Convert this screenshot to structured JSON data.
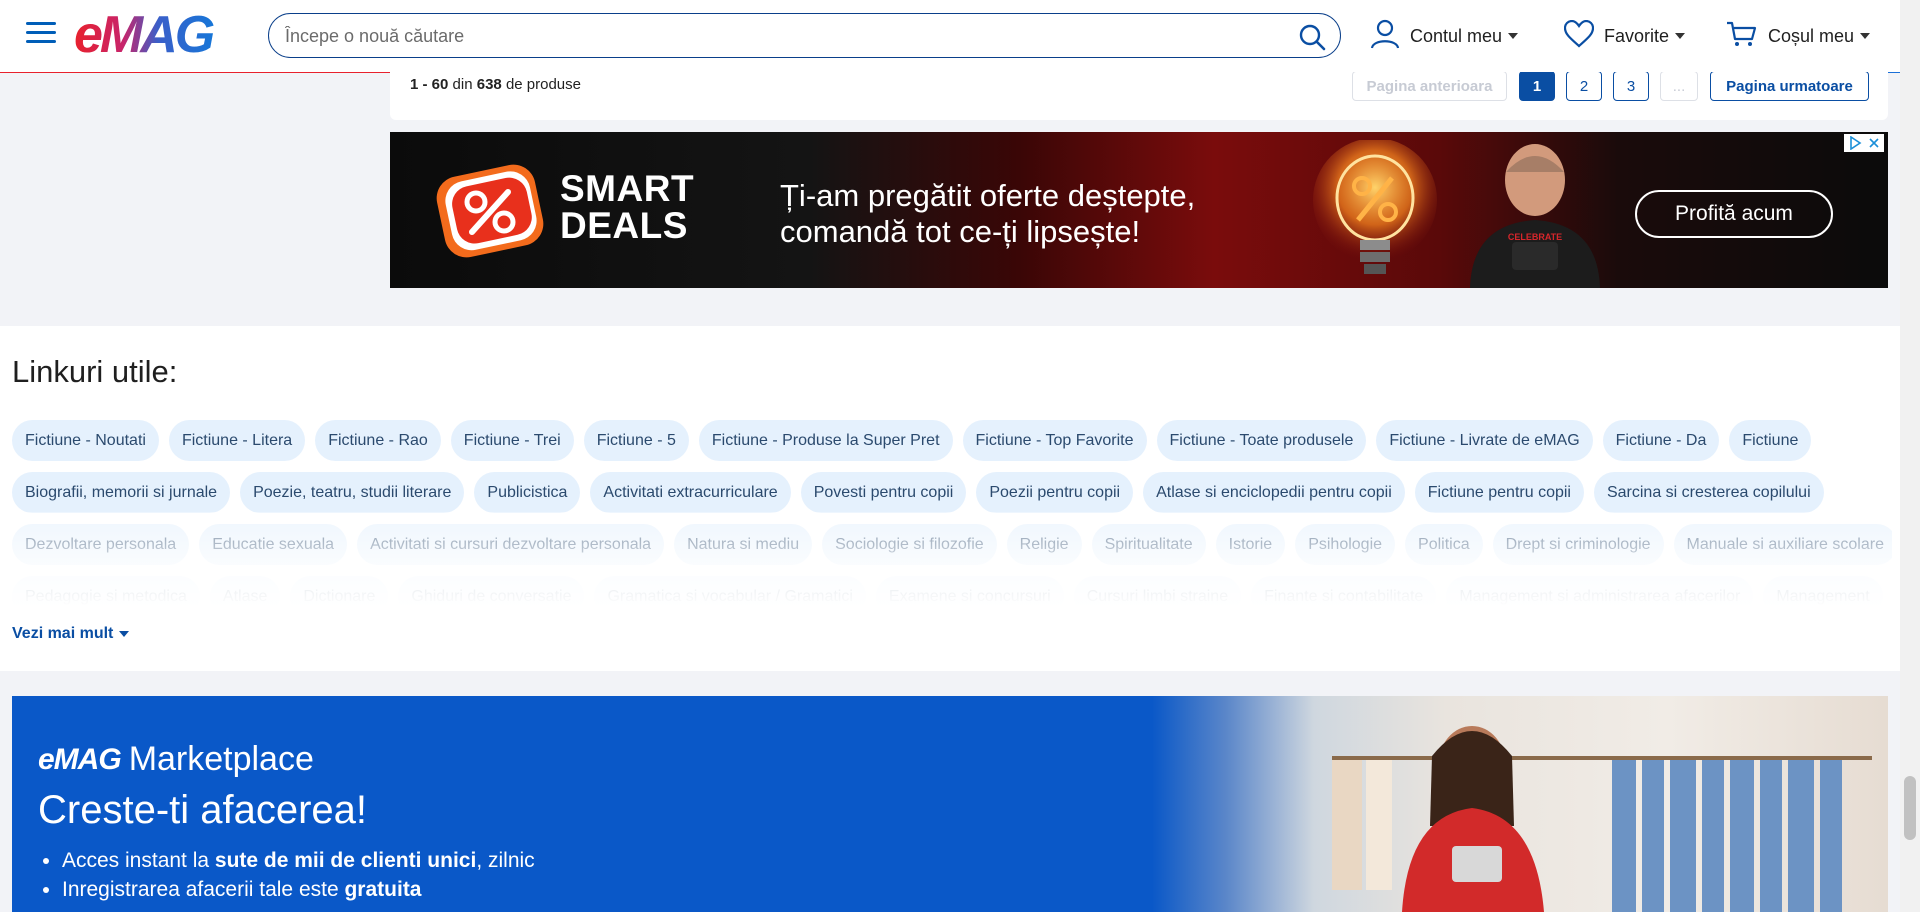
{
  "header": {
    "logo_text": "eMAG",
    "search_placeholder": "Începe o nouă căutare",
    "account_label": "Contul meu",
    "favorites_label": "Favorite",
    "cart_label": "Coșul meu"
  },
  "pagination": {
    "range": "1 - 60",
    "of_word": "din",
    "total": "638",
    "suffix": "de produse",
    "prev_label": "Pagina anterioara",
    "pages": [
      "1",
      "2",
      "3"
    ],
    "ellipsis": "...",
    "next_label": "Pagina urmatoare"
  },
  "banner": {
    "brand_line1": "SMART",
    "brand_line2": "DEALS",
    "tagline_line1": "Ți-am pregătit oferte deștepte,",
    "tagline_line2": "comandă tot ce-ți lipsește!",
    "cta_label": "Profită acum",
    "shirt_text": "CELEBRATE"
  },
  "useful_links": {
    "title": "Linkuri utile:",
    "rows": [
      [
        "Fictiune - Noutati",
        "Fictiune - Litera",
        "Fictiune - Rao",
        "Fictiune - Trei",
        "Fictiune - 5",
        "Fictiune - Produse la Super Pret",
        "Fictiune - Top Favorite",
        "Fictiune - Toate produsele",
        "Fictiune - Livrate de eMAG",
        "Fictiune - Da",
        "Fictiune"
      ],
      [
        "Biografii, memorii si jurnale",
        "Poezie, teatru, studii literare",
        "Publicistica",
        "Activitati extracurriculare",
        "Povesti pentru copii",
        "Poezii pentru copii",
        "Atlase si enciclopedii pentru copii",
        "Fictiune pentru copii",
        "Sarcina si cresterea copilului"
      ],
      [
        "Dezvoltare personala",
        "Educatie sexuala",
        "Activitati si cursuri dezvoltare personala",
        "Natura si mediu",
        "Sociologie si filozofie",
        "Religie",
        "Spiritualitate",
        "Istorie",
        "Psihologie",
        "Politica",
        "Drept si criminologie",
        "Manuale si auxiliare scolare"
      ],
      [
        "Pedagogie si metodica",
        "Atlase",
        "Dictionare",
        "Ghiduri de conversatie",
        "Gramatica si vocabular / Gramatici",
        "Examene si concursuri",
        "Cursuri limbi straine",
        "Finante si contabilitate",
        "Management si administrarea afacerilor",
        "Management"
      ]
    ],
    "more_label": "Vezi mai mult"
  },
  "marketplace": {
    "logo_emag": "eMAG",
    "logo_word": "Marketplace",
    "title": "Creste-ti afacerea!",
    "bullet1_pre": "Acces instant la ",
    "bullet1_bold": "sute de mii de clienti unici",
    "bullet1_post": ", zilnic",
    "bullet2_pre": "Inregistrarea afacerii tale este ",
    "bullet2_bold": "gratuita"
  },
  "colors": {
    "brand_blue": "#0a4ea3",
    "emag_red": "#e8212d",
    "chip_bg": "#e5f1fd",
    "market_blue": "#0a58c8"
  }
}
